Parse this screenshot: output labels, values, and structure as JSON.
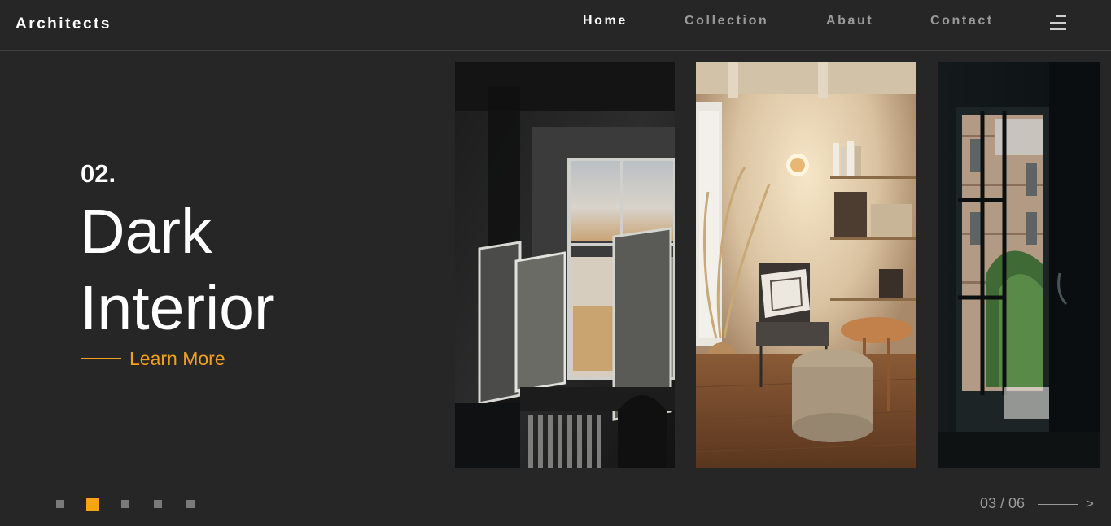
{
  "header": {
    "logo": "Architects",
    "nav": {
      "home": "Home",
      "collection": "Collection",
      "about": "Abaut",
      "contact": "Contact"
    },
    "menu_icon": "hamburger-menu-icon"
  },
  "hero": {
    "slide_number": "02.",
    "title_line1": "Dark",
    "title_line2": "Interior",
    "learn_more": "Learn More"
  },
  "cards": [
    {
      "subject": "open dark window interior"
    },
    {
      "subject": "warm cozy reading corner"
    },
    {
      "subject": "dark doorway to brick building"
    }
  ],
  "pagination": {
    "active_index": 1,
    "dot_count": 5
  },
  "counter": {
    "text": "03 / 06",
    "next_label": ">"
  },
  "colors": {
    "background": "#262626",
    "accent": "#f5a511",
    "muted": "#9a9a9a",
    "text": "#ffffff"
  }
}
